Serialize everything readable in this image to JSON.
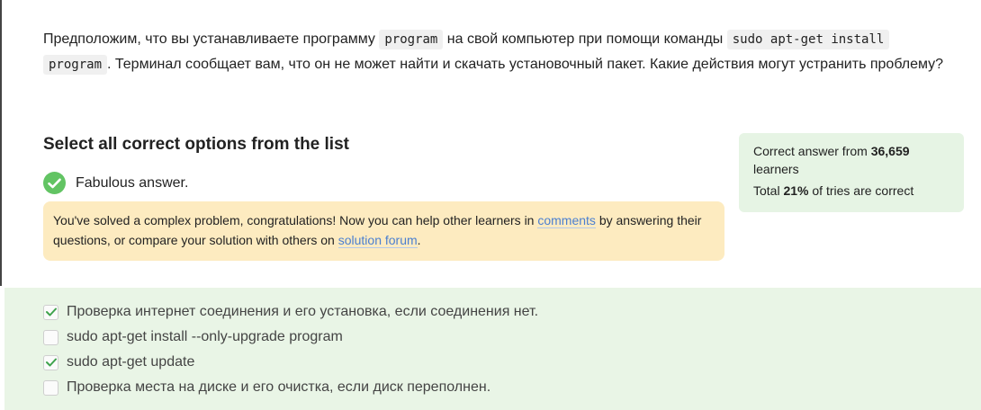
{
  "question": {
    "text_1": "Предположим, что вы устанавливаете программу ",
    "code_1": "program",
    "text_2": " на свой компьютер при помощи команды ",
    "code_2a": "sudo apt-get install",
    "code_2b": "program",
    "text_3": ". Терминал сообщает вам, что он не может найти и скачать установочный пакет. Какие действия могут устранить проблему?"
  },
  "instruction": "Select all correct options from the list",
  "result": {
    "text": "Fabulous answer.",
    "icon": "check-circle-icon",
    "color": "#62c463"
  },
  "hint": {
    "text_1": "You've solved a complex problem, congratulations! Now you can help other learners in ",
    "link_comments": "comments",
    "text_2": " by answering their questions, or compare your solution with others on ",
    "link_forum": "solution forum",
    "text_3": "."
  },
  "stats": {
    "prefix_1": "Correct answer from ",
    "learners_count": "36,659",
    "suffix_1": "learners",
    "prefix_2": "Total ",
    "percent": "21%",
    "suffix_2": " of tries are correct"
  },
  "options": [
    {
      "label": "Проверка интернет соединения и его установка, если соединения нет.",
      "checked": true
    },
    {
      "label": "sudo apt-get install --only-upgrade program",
      "checked": false
    },
    {
      "label": "sudo apt-get update",
      "checked": true
    },
    {
      "label": "Проверка места на диске и его очистка, если диск переполнен.",
      "checked": false
    }
  ]
}
